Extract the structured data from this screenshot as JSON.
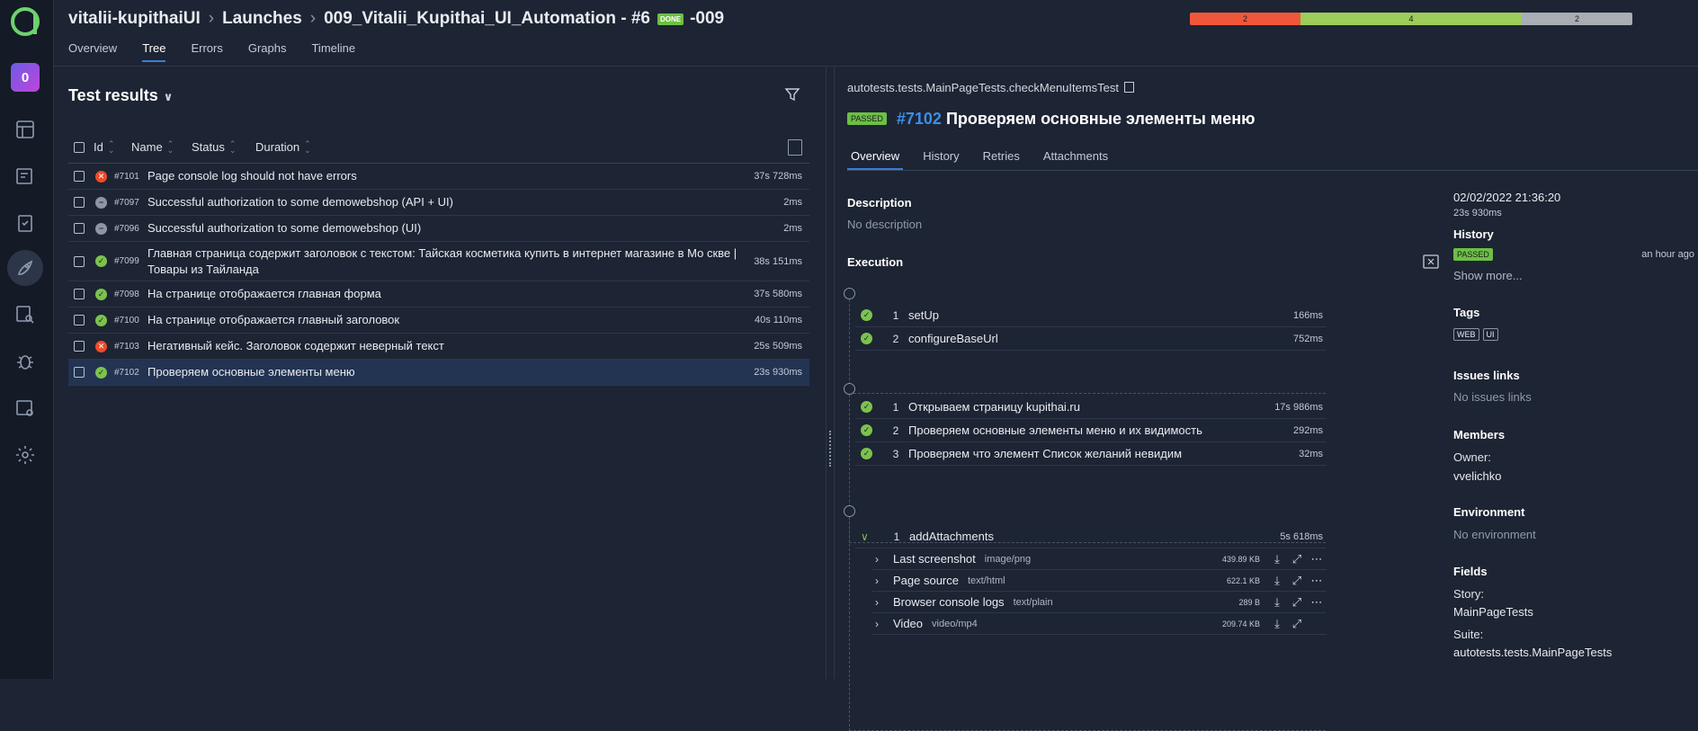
{
  "rail": {
    "project_letter": "0"
  },
  "breadcrumbs": [
    "vitalii-kupithaiUI",
    "Launches",
    "009_Vitalii_Kupithai_UI_Automation - #6"
  ],
  "launch_badge": "DONE",
  "launch_suffix": "-009",
  "top_tabs": [
    "Overview",
    "Tree",
    "Errors",
    "Graphs",
    "Timeline"
  ],
  "statusbar": {
    "failed": 2,
    "passed": 4,
    "skipped": 2,
    "colors": {
      "failed": "#f0573a",
      "passed": "#9ccc5a",
      "skipped": "#a9adb4"
    }
  },
  "test_results": {
    "title": "Test results",
    "columns": [
      "Id",
      "Name",
      "Status",
      "Duration"
    ],
    "rows": [
      {
        "status": "failed",
        "id": "#7101",
        "name": "Page console log should not have errors",
        "duration": "37s 728ms"
      },
      {
        "status": "skipped",
        "id": "#7097",
        "name": "Successful authorization to some demowebshop (API + UI)",
        "duration": "2ms"
      },
      {
        "status": "skipped",
        "id": "#7096",
        "name": "Successful authorization to some demowebshop (UI)",
        "duration": "2ms"
      },
      {
        "status": "passed",
        "id": "#7099",
        "name": "Главная страница содержит заголовок с текстом: Тайская косметика купить в интернет магазине в Мо скве | Товары из Тайланда",
        "duration": "38s 151ms"
      },
      {
        "status": "passed",
        "id": "#7098",
        "name": "На странице отображается главная форма",
        "duration": "37s 580ms"
      },
      {
        "status": "passed",
        "id": "#7100",
        "name": "На странице отображается главный заголовок",
        "duration": "40s 110ms"
      },
      {
        "status": "failed",
        "id": "#7103",
        "name": "Негативный кейс. Заголовок содержит неверный текст",
        "duration": "25s 509ms"
      },
      {
        "status": "passed",
        "id": "#7102",
        "name": "Проверяем основные элементы меню",
        "duration": "23s 930ms",
        "selected": true
      }
    ]
  },
  "detail": {
    "path": "autotests.tests.MainPageTests.checkMenuItemsTest",
    "status_badge": "PASSED",
    "number": "#7102",
    "title": "Проверяем основные элементы меню",
    "tabs": [
      "Overview",
      "History",
      "Retries",
      "Attachments"
    ],
    "description_label": "Description",
    "description": "No description",
    "execution_label": "Execution",
    "setup": [
      {
        "n": "1",
        "name": "setUp",
        "dur": "166ms"
      },
      {
        "n": "2",
        "name": "configureBaseUrl",
        "dur": "752ms"
      }
    ],
    "body": [
      {
        "n": "1",
        "name": "Открываем страницу kupithai.ru",
        "dur": "17s 986ms"
      },
      {
        "n": "2",
        "name": "Проверяем основные элементы меню и их видимость",
        "dur": "292ms"
      },
      {
        "n": "3",
        "name": "Проверяем что элемент Список желаний невидим",
        "dur": "32ms"
      }
    ],
    "teardown": {
      "n": "1",
      "name": "addAttachments",
      "dur": "5s 618ms"
    },
    "attachments": [
      {
        "name": "Last screenshot",
        "type": "image/png",
        "size": "439.89 KB"
      },
      {
        "name": "Page source",
        "type": "text/html",
        "size": "622.1 KB"
      },
      {
        "name": "Browser console logs",
        "type": "text/plain",
        "size": "289 B"
      },
      {
        "name": "Video",
        "type": "video/mp4",
        "size": "209.74 KB"
      }
    ]
  },
  "sidebar": {
    "date": "02/02/2022 21:36:20",
    "duration": "23s 930ms",
    "history_label": "History",
    "history_badge": "PASSED",
    "history_time": "an hour ago",
    "show_more": "Show more...",
    "tags_label": "Tags",
    "tags": [
      "WEB",
      "UI"
    ],
    "issues_label": "Issues links",
    "issues": "No issues links",
    "members_label": "Members",
    "owner_label": "Owner:",
    "owner": "vvelichko",
    "env_label": "Environment",
    "env": "No environment",
    "fields_label": "Fields",
    "story_label": "Story:",
    "story": "MainPageTests",
    "suite_label": "Suite:",
    "suite": "autotests.tests.MainPageTests"
  }
}
